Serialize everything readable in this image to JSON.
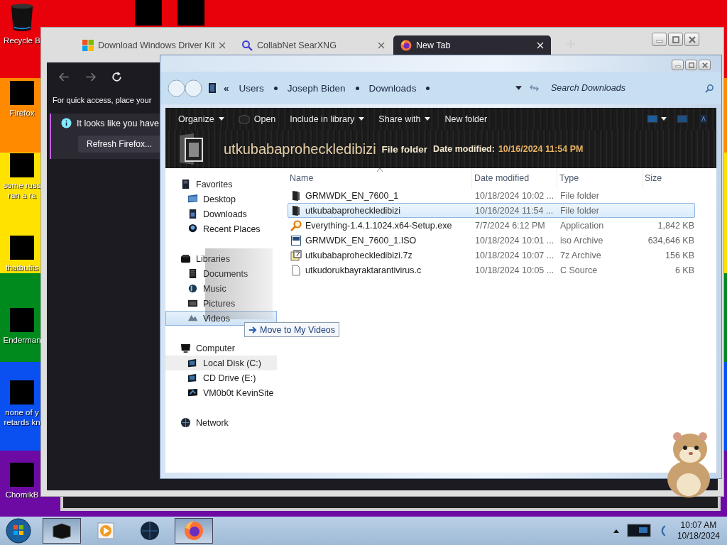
{
  "desktop": {
    "icons": [
      {
        "lines": [
          "Recycle B"
        ],
        "kind": "bin"
      },
      {
        "lines": [
          "Firefox"
        ],
        "kind": "app"
      },
      {
        "lines": [
          "some russ",
          "ran a ra"
        ],
        "kind": "app"
      },
      {
        "lines": [
          "thatbutits"
        ],
        "kind": "app"
      },
      {
        "lines": [
          "Enderman"
        ],
        "kind": "app"
      },
      {
        "lines": [
          "none of y",
          "retards kn"
        ],
        "kind": "app"
      },
      {
        "lines": [
          "ChomikB"
        ],
        "kind": "app"
      }
    ]
  },
  "browser": {
    "tabs": [
      {
        "title": "Download Windows Driver Kit",
        "kind": "windows",
        "selected": false
      },
      {
        "title": "CollabNet SearXNG",
        "kind": "search",
        "selected": false
      },
      {
        "title": "New Tab",
        "kind": "firefox",
        "selected": true
      }
    ],
    "quick_access_text": "For quick access, place your",
    "notification": {
      "text": "It looks like you have",
      "button": "Refresh Firefox..."
    }
  },
  "explorer": {
    "address": {
      "overflow": "«",
      "crumbs": [
        "Users",
        "Joseph Biden",
        "Downloads"
      ]
    },
    "search": {
      "placeholder": "Search Downloads"
    },
    "toolbar": [
      {
        "label": "Organize",
        "dropdown": true,
        "kind": "plain"
      },
      {
        "label": "Open",
        "dropdown": false,
        "kind": "open"
      },
      {
        "label": "Include in library",
        "dropdown": true,
        "kind": "plain"
      },
      {
        "label": "Share with",
        "dropdown": true,
        "kind": "plain"
      },
      {
        "label": "New folder",
        "dropdown": false,
        "kind": "plain"
      }
    ],
    "details": {
      "name": "utkubabaproheckledibizi",
      "type": "File folder",
      "date_label": "Date modified:",
      "date": "10/16/2024 11:54 PM"
    },
    "nav": [
      {
        "label": "Favorites",
        "kind": "star",
        "drop_target": false,
        "hovered": false,
        "children": [
          {
            "label": "Desktop",
            "kind": "desktop",
            "drop_target": false,
            "hovered": false
          },
          {
            "label": "Downloads",
            "kind": "downloads",
            "drop_target": false,
            "hovered": false
          },
          {
            "label": "Recent Places",
            "kind": "recent",
            "drop_target": false,
            "hovered": false
          }
        ]
      },
      {
        "label": "Libraries",
        "kind": "library",
        "drop_target": false,
        "hovered": false,
        "children": [
          {
            "label": "Documents",
            "kind": "documents",
            "drop_target": false,
            "hovered": false
          },
          {
            "label": "Music",
            "kind": "music",
            "drop_target": false,
            "hovered": false
          },
          {
            "label": "Pictures",
            "kind": "pictures",
            "drop_target": false,
            "hovered": false
          },
          {
            "label": "Videos",
            "kind": "videos",
            "drop_target": true,
            "hovered": false
          }
        ]
      },
      {
        "label": "Computer",
        "kind": "computer",
        "drop_target": false,
        "hovered": false,
        "children": [
          {
            "label": "Local Disk (C:)",
            "kind": "drive",
            "drop_target": false,
            "hovered": true
          },
          {
            "label": "CD Drive (E:)",
            "kind": "drive",
            "drop_target": false,
            "hovered": false
          },
          {
            "label": "VM0b0t KevinSite",
            "kind": "share",
            "drop_target": false,
            "hovered": false
          }
        ]
      },
      {
        "label": "Network",
        "kind": "network",
        "drop_target": false,
        "hovered": false
      }
    ],
    "columns": [
      {
        "label": "Name",
        "sorted": true
      },
      {
        "label": "Date modified",
        "sorted": false
      },
      {
        "label": "Type",
        "sorted": false
      },
      {
        "label": "Size",
        "sorted": false
      }
    ],
    "files": [
      {
        "name": "GRMWDK_EN_7600_1",
        "date": "10/18/2024 10:02 ...",
        "type": "File folder",
        "kind": "folder",
        "selected": false
      },
      {
        "name": "utkubabaproheckledibizi",
        "date": "10/16/2024 11:54 ...",
        "type": "File folder",
        "kind": "folder",
        "selected": true
      },
      {
        "name": "Everything-1.4.1.1024.x64-Setup.exe",
        "date": "7/7/2024 6:12 PM",
        "type": "Application",
        "size": "1,842 KB",
        "kind": "exe",
        "selected": false
      },
      {
        "name": "GRMWDK_EN_7600_1.ISO",
        "date": "10/18/2024 10:01 ...",
        "type": "iso Archive",
        "size": "634,646 KB",
        "kind": "iso",
        "selected": false
      },
      {
        "name": "utkubabaproheckledibizi.7z",
        "date": "10/18/2024 10:07 ...",
        "type": "7z Archive",
        "size": "156 KB",
        "kind": "archive",
        "selected": false
      },
      {
        "name": "utkudorukbayraktarantivirus.c",
        "date": "10/18/2024 10:05 ...",
        "type": "C Source",
        "size": "6 KB",
        "kind": "source",
        "selected": false
      }
    ],
    "drag_tooltip": "Move to My Videos"
  },
  "taskbar": {
    "items": [
      {
        "kind": "explorer",
        "active": true
      },
      {
        "kind": "media",
        "active": false
      },
      {
        "kind": "globe",
        "active": false
      },
      {
        "kind": "firefox",
        "active": true
      }
    ],
    "clock": {
      "time": "10:07 AM",
      "date": "10/18/2024"
    }
  }
}
